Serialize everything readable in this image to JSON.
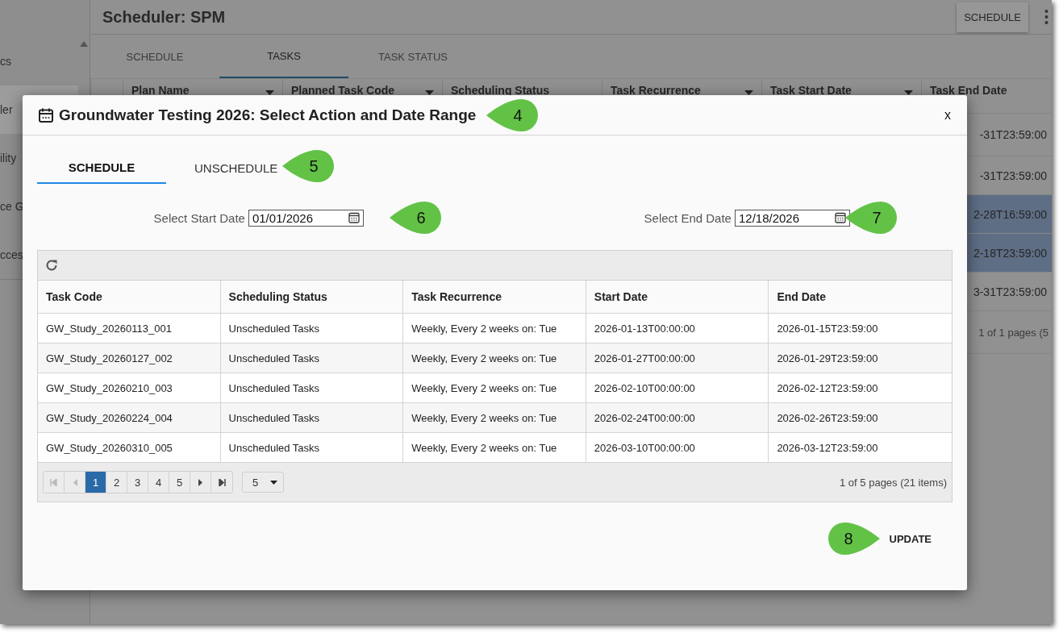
{
  "app": {
    "title": "Scheduler: SPM",
    "action_button": "SCHEDULE",
    "sidebar": [
      {
        "label": "cs",
        "selected": false
      },
      {
        "label": "ler",
        "selected": true
      },
      {
        "label": "ility",
        "selected": false
      },
      {
        "label": "ce G",
        "selected": false
      },
      {
        "label": "cces",
        "selected": false
      }
    ],
    "tabs": [
      {
        "label": "SCHEDULE",
        "selected": false
      },
      {
        "label": "TASKS",
        "selected": true
      },
      {
        "label": "TASK STATUS",
        "selected": false
      }
    ],
    "grid": {
      "columns": [
        {
          "label": "Plan Name",
          "filter": true
        },
        {
          "label": "Planned Task Code",
          "filter": true
        },
        {
          "label": "Scheduling Status",
          "filter": false
        },
        {
          "label": "Task Recurrence",
          "filter": true
        },
        {
          "label": "Task Start Date",
          "filter": true
        },
        {
          "label": "Task End Date",
          "filter": false
        }
      ],
      "rows": [
        {
          "end_date": "-31T23:59:00",
          "selected": false
        },
        {
          "end_date": "-31T23:59:00",
          "selected": false
        },
        {
          "end_date": "2-28T16:59:00",
          "selected": true
        },
        {
          "end_date": "2-18T23:59:00",
          "selected": true
        },
        {
          "end_date": "3-31T23:59:00",
          "selected": false
        }
      ],
      "pager": "1 of 1 pages (5"
    }
  },
  "dialog": {
    "title": "Groundwater Testing 2026: Select Action and Date Range",
    "close": "x",
    "tabs": [
      {
        "label": "SCHEDULE",
        "selected": true
      },
      {
        "label": "UNSCHEDULE",
        "selected": false
      }
    ],
    "start": {
      "label": "Select Start Date",
      "value": "01/01/2026"
    },
    "end": {
      "label": "Select End Date",
      "value": "12/18/2026"
    },
    "table": {
      "columns": [
        "Task Code",
        "Scheduling Status",
        "Task Recurrence",
        "Start Date",
        "End Date"
      ],
      "rows": [
        [
          "GW_Study_20260113_001",
          "Unscheduled Tasks",
          "Weekly, Every 2 weeks on: Tue",
          "2026-01-13T00:00:00",
          "2026-01-15T23:59:00"
        ],
        [
          "GW_Study_20260127_002",
          "Unscheduled Tasks",
          "Weekly, Every 2 weeks on: Tue",
          "2026-01-27T00:00:00",
          "2026-01-29T23:59:00"
        ],
        [
          "GW_Study_20260210_003",
          "Unscheduled Tasks",
          "Weekly, Every 2 weeks on: Tue",
          "2026-02-10T00:00:00",
          "2026-02-12T23:59:00"
        ],
        [
          "GW_Study_20260224_004",
          "Unscheduled Tasks",
          "Weekly, Every 2 weeks on: Tue",
          "2026-02-24T00:00:00",
          "2026-02-26T23:59:00"
        ],
        [
          "GW_Study_20260310_005",
          "Unscheduled Tasks",
          "Weekly, Every 2 weeks on: Tue",
          "2026-03-10T00:00:00",
          "2026-03-12T23:59:00"
        ]
      ]
    },
    "pager": {
      "first_disabled": true,
      "prev_disabled": true,
      "pages": [
        {
          "label": "1",
          "selected": true
        },
        {
          "label": "2",
          "selected": false
        },
        {
          "label": "3",
          "selected": false
        },
        {
          "label": "4",
          "selected": false
        },
        {
          "label": "5",
          "selected": false
        }
      ],
      "page_size": "5",
      "info": "1 of 5 pages (21 items)"
    },
    "update_button": "UPDATE"
  },
  "callouts": [
    {
      "number": "4",
      "kind": "left"
    },
    {
      "number": "5",
      "kind": "left"
    },
    {
      "number": "6",
      "kind": "left"
    },
    {
      "number": "7",
      "kind": "left"
    },
    {
      "number": "8",
      "kind": "right"
    }
  ]
}
